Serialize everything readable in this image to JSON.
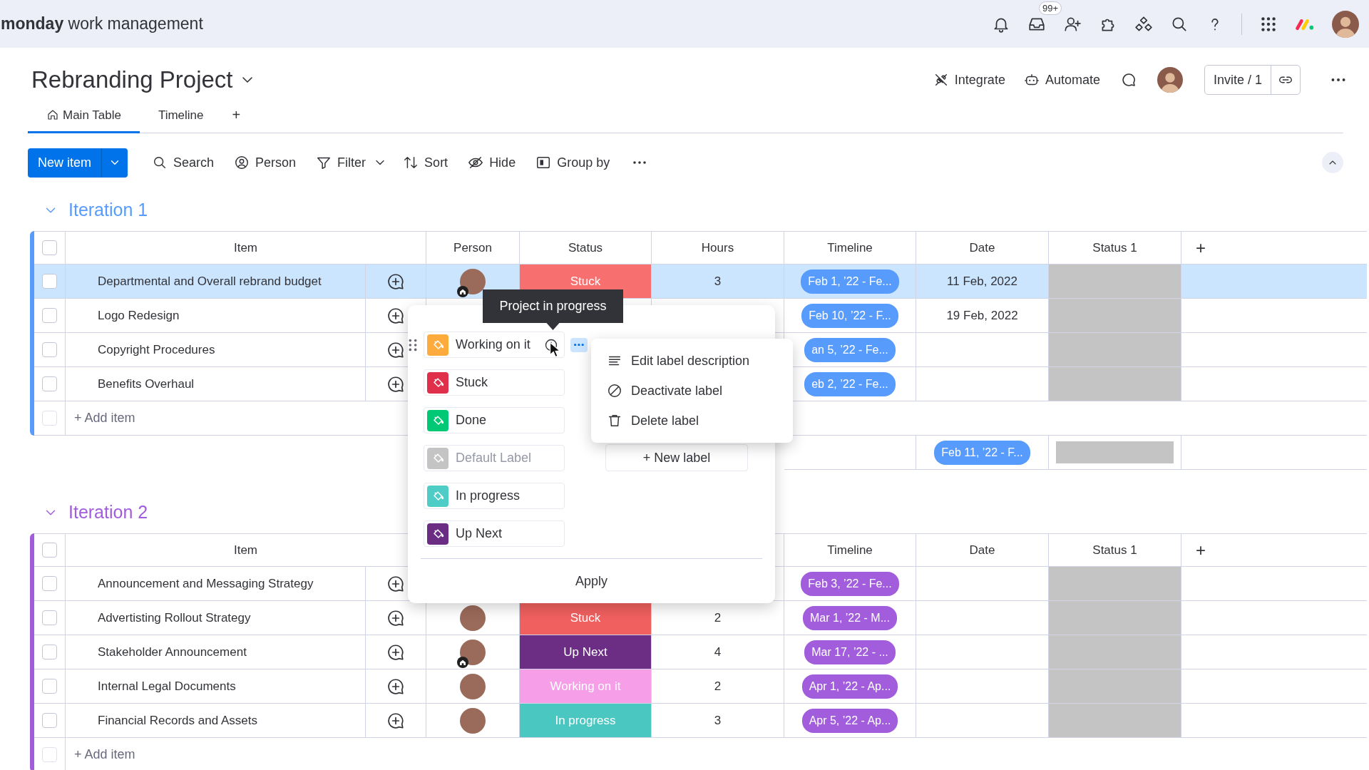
{
  "topbar": {
    "brand_bold": "monday",
    "brand_rest": "work management",
    "icons": [
      {
        "kind": "bell"
      },
      {
        "kind": "inbox",
        "badge": "99+"
      },
      {
        "kind": "invite"
      },
      {
        "kind": "puzzle"
      },
      {
        "kind": "network"
      },
      {
        "kind": "search"
      },
      {
        "kind": "help"
      },
      {
        "kind": "divider"
      },
      {
        "kind": "grid"
      },
      {
        "kind": "logo"
      },
      {
        "kind": "avatar"
      }
    ]
  },
  "board": {
    "title": "Rebranding Project",
    "actions": [
      {
        "kind": "integrate",
        "label": "Integrate"
      },
      {
        "kind": "automate",
        "label": "Automate"
      },
      {
        "kind": "chat"
      },
      {
        "kind": "avatar"
      }
    ],
    "invite": "Invite / 1"
  },
  "tabs": [
    {
      "label": "Main Table",
      "selected": true
    },
    {
      "label": "Timeline",
      "selected": false
    }
  ],
  "add_tab": "+",
  "toolbar": {
    "new_item": "New item",
    "tools": [
      {
        "kind": "search",
        "label": "Search"
      },
      {
        "kind": "person",
        "label": "Person"
      },
      {
        "kind": "filter",
        "label": "Filter",
        "caret": true
      },
      {
        "kind": "sort",
        "label": "Sort"
      },
      {
        "kind": "hide",
        "label": "Hide"
      },
      {
        "kind": "group",
        "label": "Group by"
      },
      {
        "kind": "more"
      }
    ]
  },
  "groups": [
    {
      "title": "Iteration 1",
      "color": "#579bfc",
      "expanded": true,
      "all_checked": false,
      "add_row_checked": false,
      "header": {
        "item": "Item",
        "person": "Person",
        "status": "Status",
        "hours": "Hours",
        "timeline": "Timeline",
        "date": "Date",
        "status_1": "Status 1",
        "add": "+"
      },
      "rows": [
        {
          "item": "Departmental and Overall rebrand budget",
          "selected": true,
          "person": {
            "home": true
          },
          "status": {
            "label": "Stuck",
            "color": "#f86f6f"
          },
          "hours": "3",
          "timeline": "Feb 1, ’22 - Fe...",
          "date": "11 Feb, 2022"
        },
        {
          "item": "Logo Redesign",
          "selected": false,
          "timeline": "Feb 10, ’22 - F...",
          "date": "19 Feb, 2022"
        },
        {
          "item": "Copyright Procedures",
          "selected": false,
          "timeline": "an 5, ’22 - Fe..."
        },
        {
          "item": "Benefits Overhaul",
          "selected": false,
          "timeline": "eb 2, ’22 - Fe..."
        }
      ],
      "add_item": "+ Add item",
      "summary": {
        "date": "Feb 11, ’22 - F..."
      }
    },
    {
      "title": "Iteration 2",
      "color": "#a25ddc",
      "expanded": true,
      "all_checked": false,
      "add_row_checked": false,
      "header": {
        "item": "Item",
        "timeline": "Timeline",
        "date": "Date",
        "status_1": "Status 1",
        "add": "+"
      },
      "rows": [
        {
          "item": "Announcement and Messaging Strategy",
          "selected": false,
          "timeline": "Feb 3, ’22 - Fe..."
        },
        {
          "item": "Advertisting Rollout Strategy",
          "selected": false,
          "person": {
            "home": false
          },
          "status": {
            "label": "Stuck",
            "color": "#f0605f"
          },
          "hours": "2",
          "timeline": "Mar 1, ’22 - M..."
        },
        {
          "item": "Stakeholder Announcement",
          "selected": false,
          "person": {
            "home": true
          },
          "status": {
            "label": "Up Next",
            "color": "#6c2e85"
          },
          "hours": "4",
          "timeline": "Mar 17, ’22 - ..."
        },
        {
          "item": "Internal Legal Documents",
          "selected": false,
          "person": {
            "home": false
          },
          "status": {
            "label": "Working on it",
            "color": "#f69ee8"
          },
          "hours": "2",
          "timeline": "Apr 1, ’22 - Ap..."
        },
        {
          "item": "Financial Records and Assets",
          "selected": false,
          "person": {
            "home": false
          },
          "status": {
            "label": "In progress",
            "color": "#4ac7c0"
          },
          "hours": "3",
          "timeline": "Apr 5, ’22 - Ap..."
        }
      ],
      "add_item": "+ Add item"
    }
  ],
  "status_picker": {
    "tooltip": "Project in progress",
    "labels": [
      {
        "label": "Working on it",
        "color": "#fdab3d",
        "hovered": true,
        "muted": false
      },
      {
        "label": "Stuck",
        "color": "#df2f4a",
        "hovered": false,
        "muted": false
      },
      {
        "label": "Done",
        "color": "#00c875",
        "hovered": false,
        "muted": false
      },
      {
        "label": "Default Label",
        "color": "#c4c4c4",
        "hovered": false,
        "muted": true
      },
      {
        "label": "In progress",
        "color": "#4eccc6",
        "hovered": false,
        "muted": false
      },
      {
        "label": "Up Next",
        "color": "#6b2d83",
        "hovered": false,
        "muted": false
      }
    ],
    "new_label": "+ New label",
    "apply": "Apply",
    "menu": [
      {
        "kind": "lines",
        "label": "Edit label description"
      },
      {
        "kind": "ban",
        "label": "Deactivate label"
      },
      {
        "kind": "trash",
        "label": "Delete label"
      }
    ]
  }
}
